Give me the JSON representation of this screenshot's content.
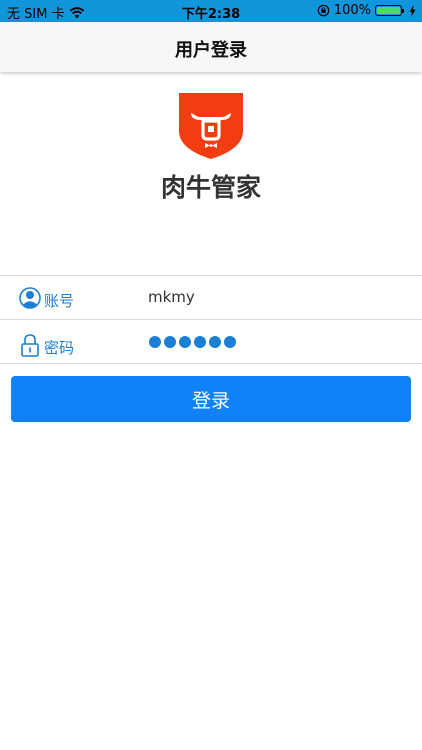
{
  "status_bar": {
    "carrier": "无 SIM 卡",
    "time": "下午2:38",
    "battery": "100%",
    "battery_level": 1.0,
    "icons": [
      "wifi-icon",
      "orientation-lock-icon",
      "battery-icon",
      "charging-icon"
    ]
  },
  "nav": {
    "title": "用户登录"
  },
  "app": {
    "name": "肉牛管家",
    "logo_icon": "bull-shield-logo"
  },
  "form": {
    "account_label": "账号",
    "account_value": "mkmy",
    "password_label": "密码",
    "password_length": 6
  },
  "login_button": "登录",
  "colors": {
    "status_bar": "#1296db",
    "primary": "#0f82f7",
    "label": "#1c7fd6",
    "logo_red": "#f23d13",
    "nav_bg": "#f7f7f7"
  }
}
